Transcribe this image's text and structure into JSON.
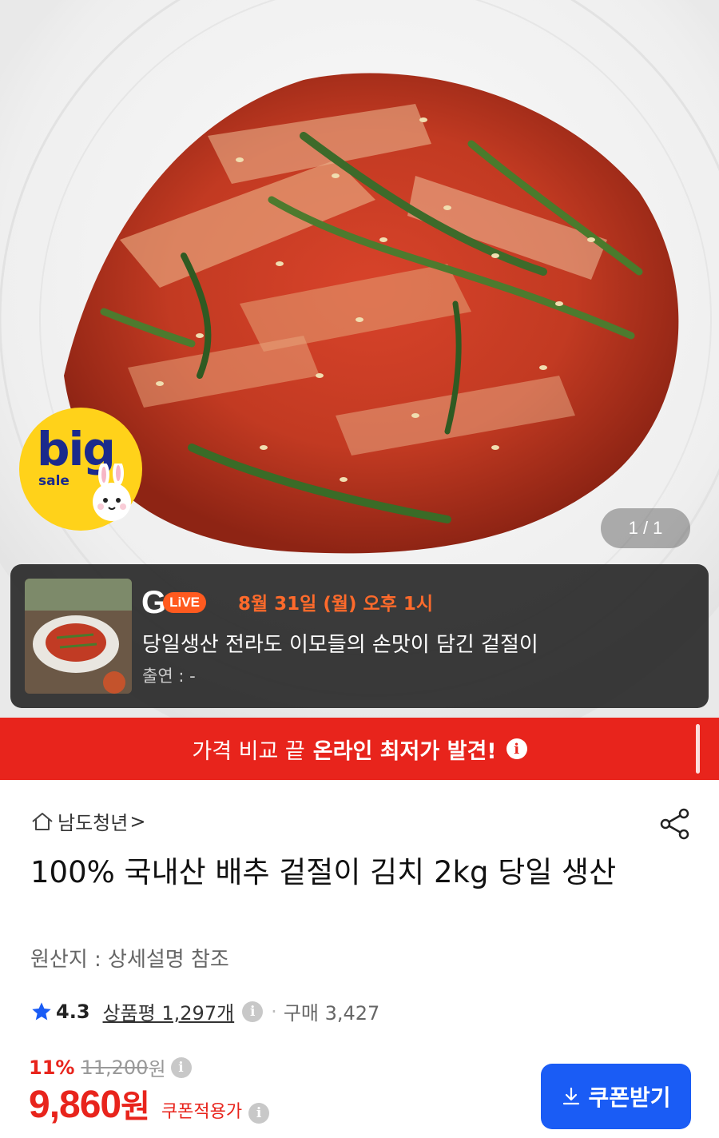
{
  "hero": {
    "counter": "1 / 1",
    "badge": {
      "big": "big",
      "sale": "sale"
    }
  },
  "live": {
    "logo_g": "G",
    "logo_live": "LiVE",
    "date": "8월 31일 (월) 오후 1시",
    "title": "당일생산 전라도 이모들의 손맛이 담긴 겉절이",
    "cast": "출연 : -"
  },
  "banner": {
    "lead": "가격 비교 끝",
    "strong": "온라인 최저가 발견!",
    "info": "i"
  },
  "product": {
    "seller": "남도청년",
    "seller_chevron": ">",
    "title": "100% 국내산 배추 겉절이 김치 2kg 당일 생산",
    "origin": "원산지 : 상세설명 참조",
    "rating": "4.3",
    "reviews": "상품평 1,297개",
    "info": "i",
    "dot": "·",
    "purchases": "구매 3,427",
    "discount_pct": "11%",
    "original_price": "11,200",
    "currency": "원",
    "price": "9,860",
    "price_currency": "원",
    "coupon_price_label": "쿠폰적용가",
    "coupon_button": "쿠폰받기"
  },
  "colors": {
    "accent_red": "#e8241c",
    "live_orange": "#ff6a2b",
    "button_blue": "#1a5cf5",
    "badge_yellow": "#ffd21a"
  },
  "icons": [
    "home-icon",
    "chevron-right-icon",
    "share-icon",
    "star-icon",
    "info-icon",
    "download-icon",
    "bunny-icon"
  ]
}
